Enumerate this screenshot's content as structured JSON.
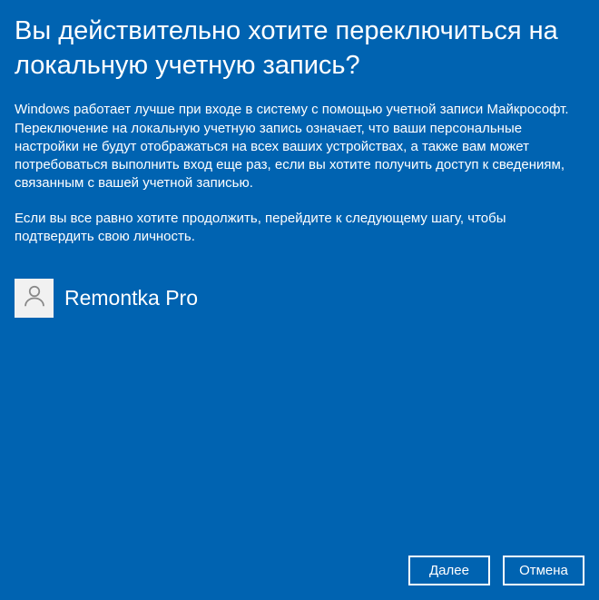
{
  "title": "Вы действительно хотите переключиться на локальную учетную запись?",
  "paragraph1": "Windows работает лучше при входе в систему с помощью учетной записи Майкрософт. Переключение на локальную учетную запись означает, что ваши персональные настройки не будут отображаться на всех ваших устройствах, а также вам может потребоваться выполнить вход еще раз, если вы хотите получить доступ к сведениям, связанным с вашей учетной записью.",
  "paragraph2": "Если вы все равно хотите продолжить, перейдите к следующему шагу, чтобы подтвердить свою личность.",
  "user": {
    "name": "Remontka Pro"
  },
  "buttons": {
    "next": "Далее",
    "cancel": "Отмена"
  }
}
